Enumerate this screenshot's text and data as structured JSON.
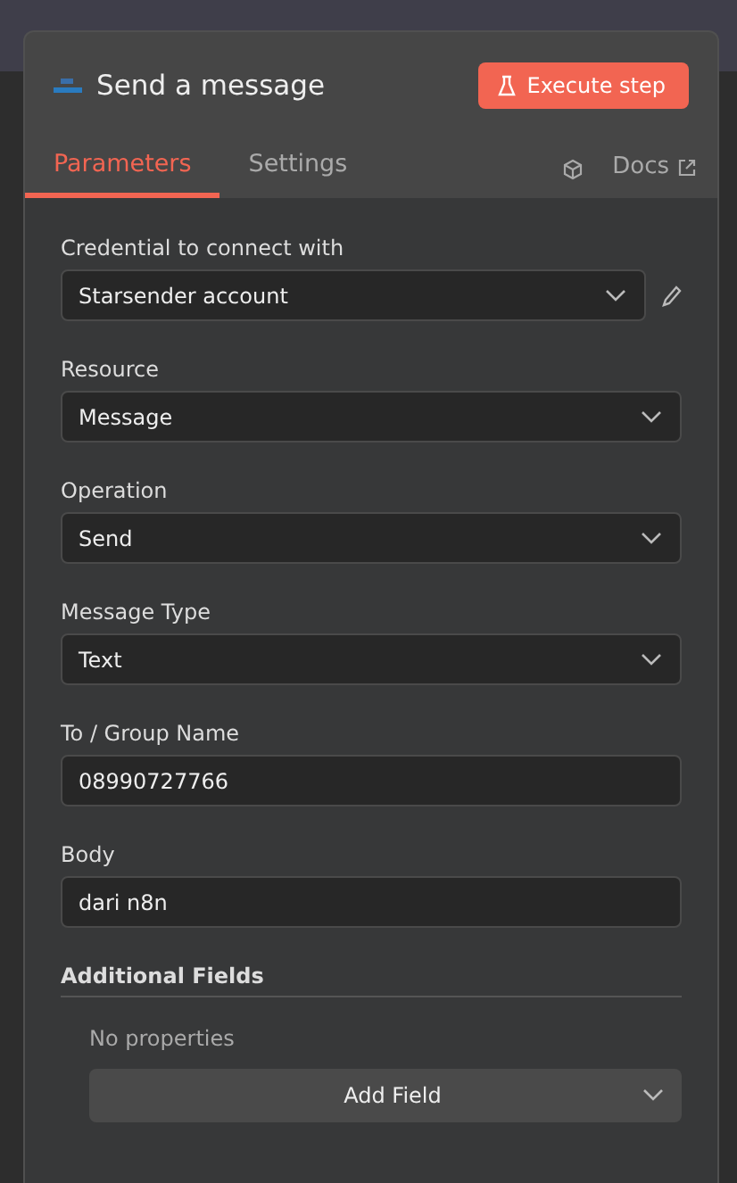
{
  "header": {
    "title": "Send a message",
    "execute_button": "Execute step"
  },
  "tabs": [
    {
      "label": "Parameters",
      "selected": true
    },
    {
      "label": "Settings",
      "selected": false
    }
  ],
  "docs_link": "Docs",
  "fields": [
    {
      "kind": "select",
      "label": "Credential to connect with",
      "value": "Starsender account",
      "editable": true
    },
    {
      "kind": "select",
      "label": "Resource",
      "value": "Message",
      "editable": false
    },
    {
      "kind": "select",
      "label": "Operation",
      "value": "Send",
      "editable": false
    },
    {
      "kind": "select",
      "label": "Message Type",
      "value": "Text",
      "editable": false
    },
    {
      "kind": "input",
      "label": "To / Group Name",
      "value": "08990727766",
      "editable": false
    },
    {
      "kind": "input",
      "label": "Body",
      "value": "dari n8n",
      "editable": false
    }
  ],
  "additional_fields": {
    "title": "Additional Fields",
    "empty_text": "No properties",
    "add_button": "Add Field"
  }
}
